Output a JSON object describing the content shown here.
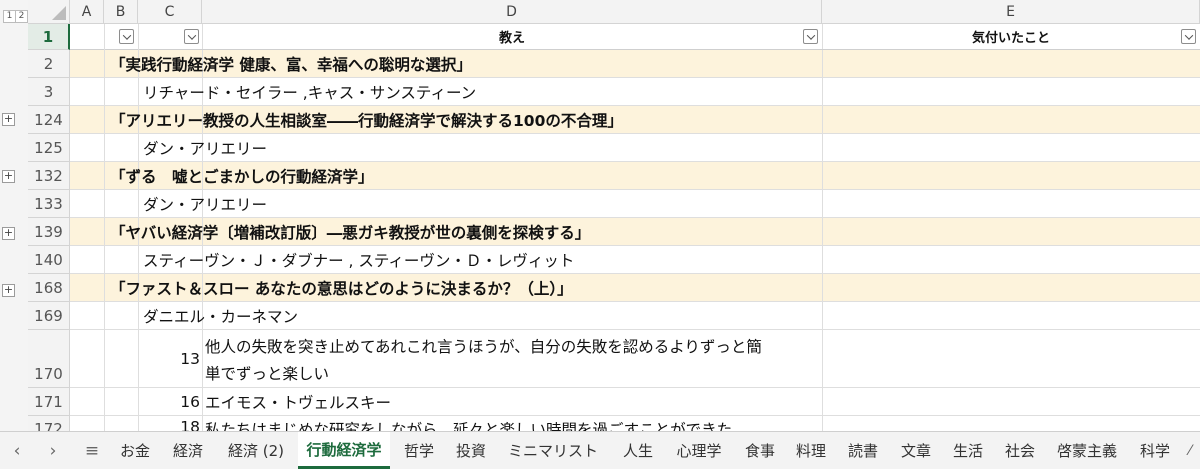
{
  "outline_levels": [
    "1",
    "2"
  ],
  "columns": [
    "A",
    "B",
    "C",
    "D",
    "E"
  ],
  "header_row": {
    "row_number": "1",
    "col_d": "教え",
    "col_e": "気付いたこと"
  },
  "rows": [
    {
      "num": "2",
      "text": "「実践行動経済学 健康、富、幸福への聡明な選択」"
    },
    {
      "num": "3",
      "text": "リチャード・セイラー ,キャス・サンスティーン"
    },
    {
      "num": "124",
      "text": "「アリエリー教授の人生相談室――行動経済学で解決する100の不合理」"
    },
    {
      "num": "125",
      "text": "ダン・アリエリー"
    },
    {
      "num": "132",
      "text": "「ずる　嘘とごまかしの行動経済学」"
    },
    {
      "num": "133",
      "text": "ダン・アリエリー"
    },
    {
      "num": "139",
      "text": "「ヤバい経済学〔増補改訂版〕―悪ガキ教授が世の裏側を探検する」"
    },
    {
      "num": "140",
      "text": "スティーヴン・Ｊ・ダブナー , スティーヴン・Ｄ・レヴィット"
    },
    {
      "num": "168",
      "text": "「ファスト＆スロー あなたの意思はどのように決まるか？（上）」"
    },
    {
      "num": "169",
      "text": "ダニエル・カーネマン"
    },
    {
      "num": "170",
      "c": "13",
      "line1": "他人の失敗を突き止めてあれこれ言うほうが、自分の失敗を認めるよりずっと簡",
      "line2": "単でずっと楽しい"
    },
    {
      "num": "171",
      "c": "16",
      "text": "エイモス・トヴェルスキー"
    },
    {
      "num": "172",
      "c": "18",
      "text": "私たちはまじめな研究をしながら、延々と楽しい時間を過ごすことができた"
    }
  ],
  "sheet_tabs": [
    "お金",
    "経済",
    "経済 (2)",
    "行動経済学",
    "哲学",
    "投資",
    "ミニマリスト",
    "人生",
    "心理学",
    "食事",
    "料理",
    "読書",
    "文章",
    "生活",
    "社会",
    "啓蒙主義",
    "科学"
  ],
  "active_tab": "行動経済学",
  "colors": {
    "band": "#fdf3dc",
    "accent": "#1d6b3d"
  }
}
